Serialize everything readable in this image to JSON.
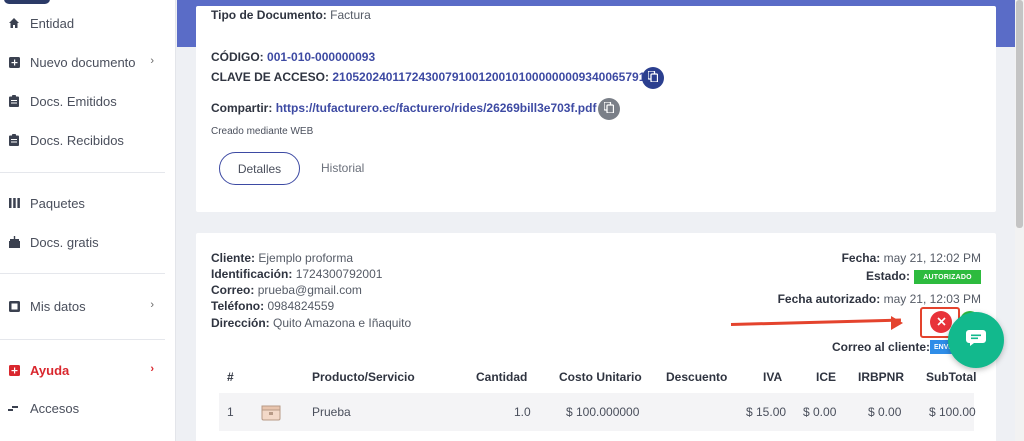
{
  "sidebar": {
    "items": [
      {
        "label": "Entidad",
        "icon": "home-icon"
      },
      {
        "label": "Nuevo documento",
        "icon": "plus-square-icon",
        "chevron": "›"
      },
      {
        "label": "Docs. Emitidos",
        "icon": "clipboard-icon"
      },
      {
        "label": "Docs. Recibidos",
        "icon": "clipboard-icon"
      },
      {
        "label": "Paquetes",
        "icon": "bars-icon"
      },
      {
        "label": "Docs. gratis",
        "icon": "gift-icon"
      },
      {
        "label": "Mis datos",
        "icon": "id-card-icon",
        "chevron": "›"
      },
      {
        "label": "Ayuda",
        "icon": "help-plus-icon",
        "chevron": "›",
        "color": "#d9272e"
      },
      {
        "label": "Accesos",
        "icon": "signal-icon"
      }
    ]
  },
  "document": {
    "tipo_label": "Tipo de Documento:",
    "tipo_value": "Factura",
    "codigo_label": "CÓDIGO:",
    "codigo_value": "001-010-000000093",
    "clave_label": "CLAVE DE ACCESO:",
    "clave_value": "2105202401172430079100120010100000000934006579116",
    "compartir_label": "Compartir:",
    "compartir_value": "https://tufacturero.ec/facturero/rides/26269bill3e703f.pdf",
    "creado": "Creado mediante WEB",
    "tabs": [
      "Detalles",
      "Historial"
    ]
  },
  "details": {
    "cliente_label": "Cliente:",
    "cliente_value": "Ejemplo proforma",
    "ident_label": "Identificación:",
    "ident_value": "1724300792001",
    "correo_label": "Correo:",
    "correo_value": "prueba@gmail.com",
    "telefono_label": "Teléfono:",
    "telefono_value": "0984824559",
    "direccion_label": "Dirección:",
    "direccion_value": "Quito Amazona e Iñaquito",
    "fecha_label": "Fecha:",
    "fecha_value": "may 21, 12:02 PM",
    "estado_label": "Estado:",
    "estado_value": "AUTORIZADO",
    "fecha_aut_label": "Fecha autorizado:",
    "fecha_aut_value": "may 21, 12:03 PM",
    "correo_cliente_label": "Correo al cliente:",
    "correo_cliente_badge": "ENVI"
  },
  "table": {
    "headers": [
      "#",
      "Producto/Servicio",
      "Cantidad",
      "Costo Unitario",
      "Descuento",
      "IVA",
      "ICE",
      "IRBPNR",
      "SubTotal"
    ],
    "rows": [
      {
        "num": "1",
        "producto": "Prueba",
        "cantidad": "1.0",
        "costo": "$ 100.000000",
        "descuento": "",
        "iva": "$ 15.00",
        "ice": "$ 0.00",
        "irbpnr": "$ 0.00",
        "subtotal": "$ 100.00"
      }
    ]
  },
  "colors": {
    "accent": "#5a6cc7",
    "link": "#3d4aa3",
    "authorized": "#2dbb3e",
    "sent": "#2e8de8",
    "danger": "#e8323a",
    "chat": "#12b98d"
  }
}
